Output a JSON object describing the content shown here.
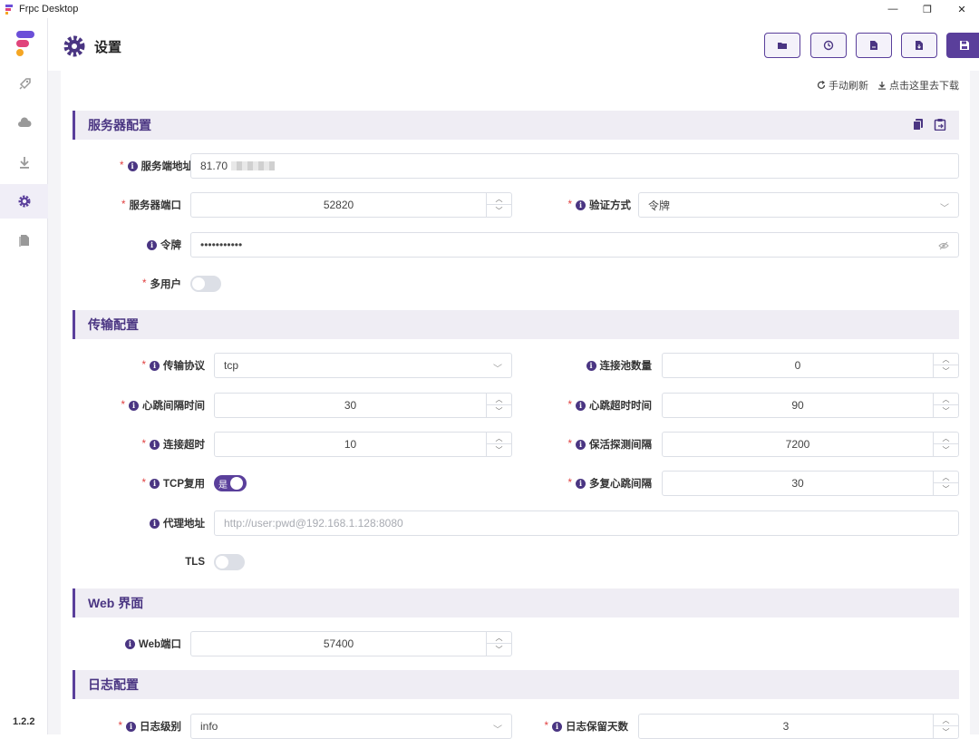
{
  "window": {
    "title": "Frpc Desktop",
    "minimize": "—",
    "restore": "❐",
    "close": "✕"
  },
  "sidebar": {
    "version": "1.2.2",
    "items": [
      "rocket-icon",
      "cloud-icon",
      "download-icon",
      "gear-icon",
      "file-icon"
    ],
    "active_index": 3
  },
  "header": {
    "title": "设置"
  },
  "toplinks": {
    "refresh": "手动刷新",
    "download": "点击这里去下载"
  },
  "sections": {
    "server": {
      "title": "服务器配置"
    },
    "transport": {
      "title": "传输配置"
    },
    "web": {
      "title": "Web 界面"
    },
    "log": {
      "title": "日志配置"
    }
  },
  "server": {
    "addr_label": "服务端地址",
    "addr_value": "81.70",
    "port_label": "服务器端口",
    "port_value": "52820",
    "auth_label": "验证方式",
    "auth_value": "令牌",
    "token_label": "令牌",
    "token_value": "•••••••••••",
    "multiuser_label": "多用户"
  },
  "transport": {
    "protocol_label": "传输协议",
    "protocol_value": "tcp",
    "pool_label": "连接池数量",
    "pool_value": "0",
    "hb_interval_label": "心跳间隔时间",
    "hb_interval_value": "30",
    "hb_timeout_label": "心跳超时时间",
    "hb_timeout_value": "90",
    "conn_timeout_label": "连接超时",
    "conn_timeout_value": "10",
    "keepalive_label": "保活探测间隔",
    "keepalive_value": "7200",
    "tcpmux_label": "TCP复用",
    "tcpmux_toggle": "是",
    "mux_hb_label": "多复心跳间隔",
    "mux_hb_value": "30",
    "proxy_label": "代理地址",
    "proxy_placeholder": "http://user:pwd@192.168.1.128:8080",
    "tls_label": "TLS"
  },
  "web": {
    "port_label": "Web端口",
    "port_value": "57400"
  },
  "log": {
    "level_label": "日志级别",
    "level_value": "info",
    "retain_label": "日志保留天数",
    "retain_value": "3"
  },
  "colors": {
    "accent": "#5a3f9b",
    "section_bg": "#efedf4",
    "required": "#e04040"
  }
}
